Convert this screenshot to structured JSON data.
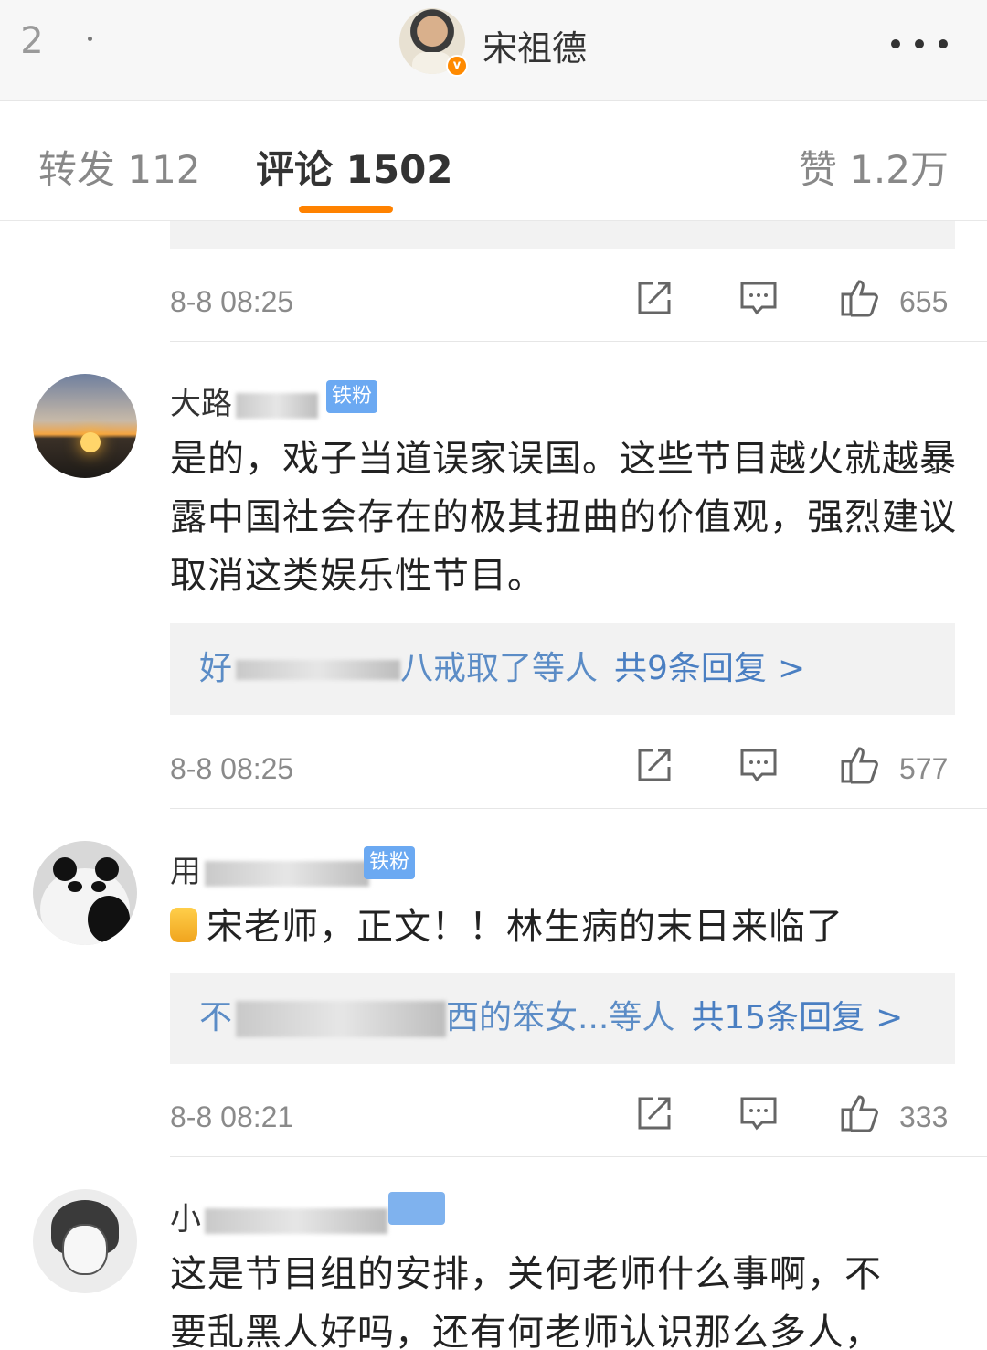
{
  "header": {
    "back_count": "2",
    "author_name": "宋祖德",
    "verified_mark": "v",
    "more_icon": "more-dots-icon"
  },
  "tabs": [
    {
      "label": "转发 112"
    },
    {
      "label": "评论 1502"
    },
    {
      "label": "赞 1.2万"
    }
  ],
  "accent_color": "#ff8200",
  "comments": [
    {
      "timestamp": "8-8 08:25",
      "likes": "655"
    },
    {
      "username_visible": "大路",
      "fan_badge": "铁粉",
      "text": "是的，戏子当道误家误国。这些节目越火就越暴露中国社会存在的极其扭曲的价值观，强烈建议取消这类娱乐性节目。",
      "reply_prefix": "好",
      "reply_names_tail": "八戒取了等人",
      "reply_count": "共9条回复",
      "reply_arrow": ">",
      "timestamp": "8-8 08:25",
      "likes": "577"
    },
    {
      "username_visible": "用",
      "fan_badge": "铁粉",
      "text": "宋老师，正文！！林生病的末日来临了",
      "reply_prefix": "不",
      "reply_names_tail": "西的笨女...等人",
      "reply_count": "共15条回复",
      "reply_arrow": ">",
      "timestamp": "8-8 08:21",
      "likes": "333"
    },
    {
      "username_visible": "小",
      "text_line1": "这是节目组的安排，关何老师什么事啊，不",
      "text_line2": "要乱黑人好吗，还有何老师认识那么多人，"
    }
  ]
}
